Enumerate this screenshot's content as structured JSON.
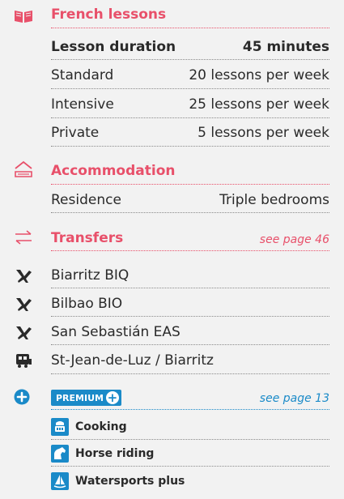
{
  "french_lessons": {
    "title": "French lessons",
    "icon": "open-book-icon",
    "duration_label": "Lesson duration",
    "duration_value": "45 minutes",
    "rows": [
      {
        "label": "Standard",
        "value": "20 lessons per week"
      },
      {
        "label": "Intensive",
        "value": "25 lessons per week"
      },
      {
        "label": "Private",
        "value": "5 lessons per week"
      }
    ]
  },
  "accommodation": {
    "title": "Accommodation",
    "icon": "house-icon",
    "rows": [
      {
        "label": "Residence",
        "value": "Triple bedrooms"
      }
    ]
  },
  "transfers": {
    "title": "Transfers",
    "icon": "transfer-arrows-icon",
    "page_ref": "see page 46",
    "rows": [
      {
        "label": "Biarritz BIQ",
        "icon": "plane-icon"
      },
      {
        "label": "Bilbao BIO",
        "icon": "plane-icon"
      },
      {
        "label": "San Sebastián EAS",
        "icon": "plane-icon"
      },
      {
        "label": "St-Jean-de-Luz / Biarritz",
        "icon": "train-icon"
      }
    ]
  },
  "premium": {
    "badge": "PREMIUM",
    "icon": "plus-circle-icon",
    "page_ref": "see page 13",
    "items": [
      {
        "label": "Cooking",
        "icon": "cooking-pot-icon"
      },
      {
        "label": "Horse riding",
        "icon": "horse-icon"
      },
      {
        "label": "Watersports plus",
        "icon": "sailboat-icon"
      }
    ]
  },
  "colors": {
    "accent_red": "#e8506a",
    "accent_blue": "#1a8ac8",
    "text": "#2a2a2a",
    "background": "#f2f2f2"
  }
}
